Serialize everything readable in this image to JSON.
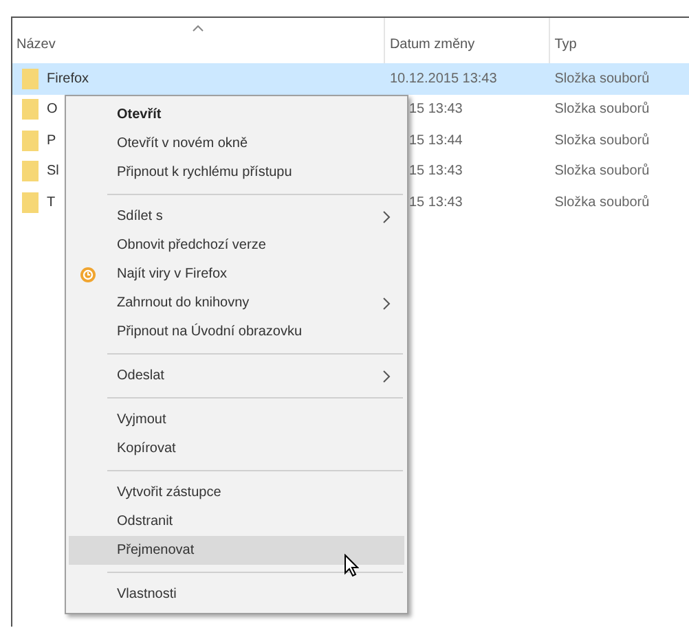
{
  "columns": [
    {
      "label": "Název",
      "sorted": true
    },
    {
      "label": "Datum změny",
      "sorted": false
    },
    {
      "label": "Typ",
      "sorted": false
    }
  ],
  "rows": [
    {
      "name": "Firefox",
      "date": "10.12.2015 13:43",
      "type": "Složka souborů",
      "selected": true
    },
    {
      "name": "O",
      "date": "15 13:43",
      "type": "Složka souborů",
      "selected": false
    },
    {
      "name": "P",
      "date": "15 13:44",
      "type": "Složka souborů",
      "selected": false
    },
    {
      "name": "Sl",
      "date": "15 13:43",
      "type": "Složka souborů",
      "selected": false
    },
    {
      "name": "T",
      "date": "15 13:43",
      "type": "Složka souborů",
      "selected": false
    }
  ],
  "context_menu": {
    "items": [
      {
        "kind": "item",
        "label": "Otevřít",
        "default": true,
        "submenu": false,
        "has_icon": false,
        "highlighted": false
      },
      {
        "kind": "item",
        "label": "Otevřít v novém okně",
        "default": false,
        "submenu": false,
        "has_icon": false,
        "highlighted": false
      },
      {
        "kind": "item",
        "label": "Připnout k rychlému přístupu",
        "default": false,
        "submenu": false,
        "has_icon": false,
        "highlighted": false
      },
      {
        "kind": "separator"
      },
      {
        "kind": "item",
        "label": "Sdílet s",
        "default": false,
        "submenu": true,
        "has_icon": false,
        "highlighted": false
      },
      {
        "kind": "item",
        "label": "Obnovit předchozí verze",
        "default": false,
        "submenu": false,
        "has_icon": false,
        "highlighted": false
      },
      {
        "kind": "item",
        "label": "Najít viry v Firefox",
        "default": false,
        "submenu": false,
        "has_icon": true,
        "highlighted": false
      },
      {
        "kind": "item",
        "label": "Zahrnout do knihovny",
        "default": false,
        "submenu": true,
        "has_icon": false,
        "highlighted": false
      },
      {
        "kind": "item",
        "label": "Připnout na Úvodní obrazovku",
        "default": false,
        "submenu": false,
        "has_icon": false,
        "highlighted": false
      },
      {
        "kind": "separator"
      },
      {
        "kind": "item",
        "label": "Odeslat",
        "default": false,
        "submenu": true,
        "has_icon": false,
        "highlighted": false
      },
      {
        "kind": "separator"
      },
      {
        "kind": "item",
        "label": "Vyjmout",
        "default": false,
        "submenu": false,
        "has_icon": false,
        "highlighted": false
      },
      {
        "kind": "item",
        "label": "Kopírovat",
        "default": false,
        "submenu": false,
        "has_icon": false,
        "highlighted": false
      },
      {
        "kind": "separator"
      },
      {
        "kind": "item",
        "label": "Vytvořit zástupce",
        "default": false,
        "submenu": false,
        "has_icon": false,
        "highlighted": false
      },
      {
        "kind": "item",
        "label": "Odstranit",
        "default": false,
        "submenu": false,
        "has_icon": false,
        "highlighted": false
      },
      {
        "kind": "item",
        "label": "Přejmenovat",
        "default": false,
        "submenu": false,
        "has_icon": false,
        "highlighted": true
      },
      {
        "kind": "separator"
      },
      {
        "kind": "item",
        "label": "Vlastnosti",
        "default": false,
        "submenu": false,
        "has_icon": false,
        "highlighted": false
      }
    ]
  }
}
